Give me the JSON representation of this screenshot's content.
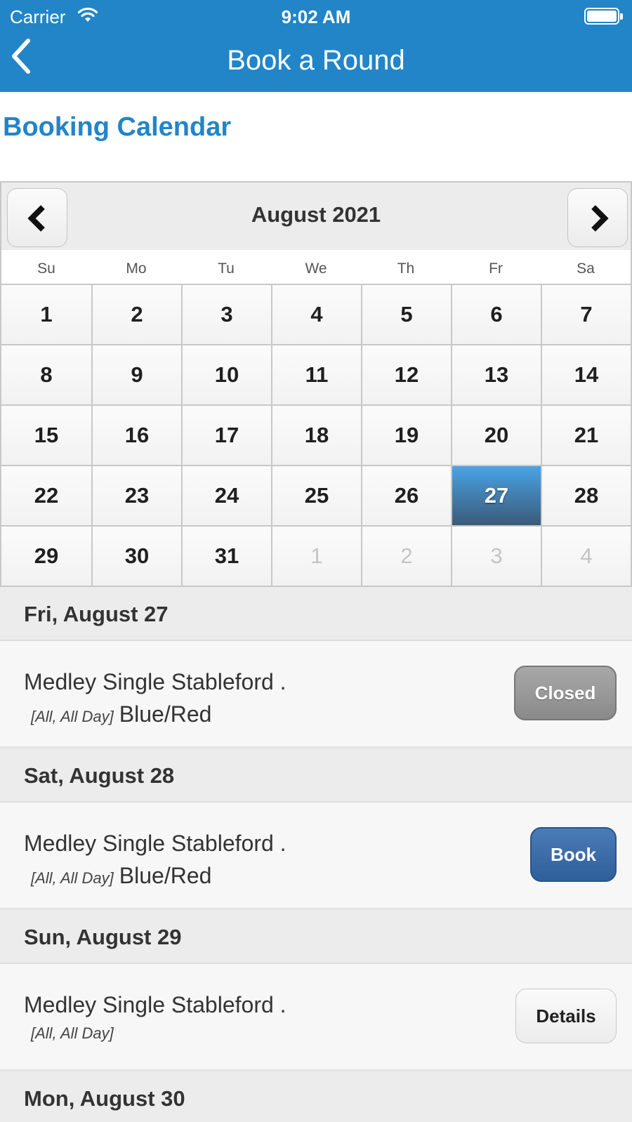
{
  "status_bar": {
    "carrier": "Carrier",
    "time": "9:02 AM"
  },
  "nav": {
    "title": "Book a Round",
    "back_icon": "chevron-left-icon"
  },
  "page": {
    "title": "Booking Calendar"
  },
  "calendar": {
    "month_label": "August 2021",
    "prev_icon": "chevron-left-icon",
    "next_icon": "chevron-right-icon",
    "weekdays": [
      "Su",
      "Mo",
      "Tu",
      "We",
      "Th",
      "Fr",
      "Sa"
    ],
    "days": [
      "1",
      "2",
      "3",
      "4",
      "5",
      "6",
      "7",
      "8",
      "9",
      "10",
      "11",
      "12",
      "13",
      "14",
      "15",
      "16",
      "17",
      "18",
      "19",
      "20",
      "21",
      "22",
      "23",
      "24",
      "25",
      "26",
      "27",
      "28",
      "29",
      "30",
      "31",
      "1",
      "2",
      "3",
      "4"
    ],
    "outside_month_start_index": 31,
    "selected_day": "27",
    "selected_color": "#3a5a78"
  },
  "events": [
    {
      "date": "Fri, August 27",
      "name": "Medley Single Stableford .",
      "tag": "[All, All Day]",
      "tees": "Blue/Red",
      "button": "Closed"
    },
    {
      "date": "Sat, August 28",
      "name": "Medley Single Stableford .",
      "tag": "[All, All Day]",
      "tees": "Blue/Red",
      "button": "Book"
    },
    {
      "date": "Sun, August 29",
      "name": "Medley Single Stableford .",
      "tag": "[All, All Day]",
      "tees": "",
      "button": "Details"
    },
    {
      "date": "Mon, August 30"
    }
  ],
  "colors": {
    "brand": "#2185c8",
    "book_button": "#2f5f9b",
    "closed_button": "#8a8a8a"
  }
}
